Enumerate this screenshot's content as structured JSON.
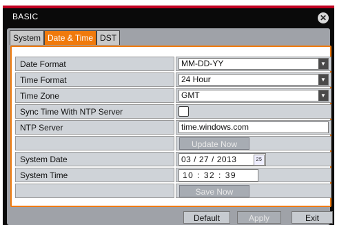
{
  "window": {
    "title": "BASIC"
  },
  "tabs": [
    {
      "label": "System"
    },
    {
      "label": "Date & Time"
    },
    {
      "label": "DST"
    }
  ],
  "settings": {
    "date_format": {
      "label": "Date Format",
      "value": "MM-DD-YY"
    },
    "time_format": {
      "label": "Time Format",
      "value": "24 Hour"
    },
    "time_zone": {
      "label": "Time Zone",
      "value": "GMT"
    },
    "ntp_sync": {
      "label": "Sync Time With NTP Server",
      "checked": false
    },
    "ntp_server": {
      "label": "NTP Server",
      "value": "time.windows.com"
    },
    "update_now": {
      "label": "Update Now"
    },
    "system_date": {
      "label": "System Date",
      "value": "03 / 27 / 2013",
      "calendar_icon_text": "25"
    },
    "system_time": {
      "label": "System Time",
      "value": "10 : 32 : 39"
    },
    "save_now": {
      "label": "Save Now"
    }
  },
  "footer": {
    "default_label": "Default",
    "apply_label": "Apply",
    "exit_label": "Exit"
  },
  "colors": {
    "accent": "#f07a0c",
    "title_bar": "#0a0a0a",
    "title_stripe": "#c00020"
  },
  "icons": {
    "close": "close-icon",
    "dropdown": "chevron-down-icon",
    "calendar": "calendar-icon"
  }
}
